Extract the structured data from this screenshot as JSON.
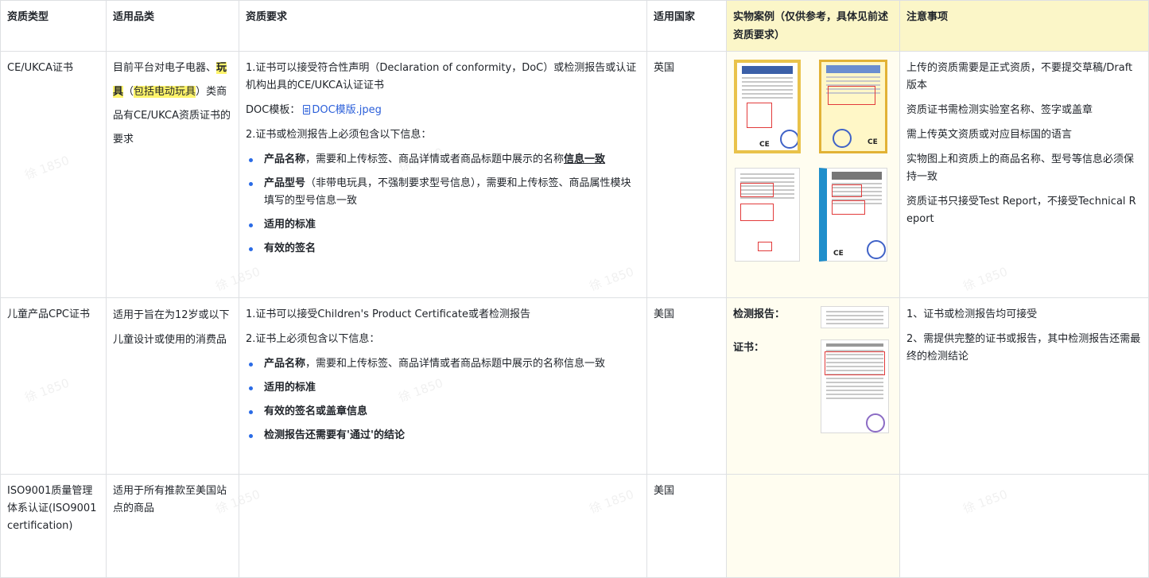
{
  "headers": [
    "资质类型",
    "适用品类",
    "资质要求",
    "适用国家",
    "实物案例（仅供参考，具体见前述资质要求）",
    "注意事项"
  ],
  "watermark": "徐 1850",
  "row1": {
    "type": "CE/UKCA证书",
    "category_pre": "目前平台对电子电器、",
    "category_hl1": "玩具",
    "category_paren_open": "（",
    "category_hl2": "包括电动玩具",
    "category_paren_close": "）",
    "category_post": "类商品有CE/UKCA资质证书的要求",
    "req_p1": "1.证书可以接受符合性声明（Declaration of conformity，DoC）或检测报告或认证机构出具的CE/UKCA认证证书",
    "doc_label": "DOC模板：",
    "doc_link": "DOC模版.jpeg",
    "req_p2": "2.证书或检测报告上必须包含以下信息：",
    "bullet1_b": "产品名称",
    "bullet1_t": "，需要和上传标签、商品详情或者商品标题中展示的名称",
    "bullet1_b2": "信息一致",
    "bullet2_b": "产品型号",
    "bullet2_t": "（非带电玩具，不强制要求型号信息），需要和上传标签、商品属性模块填写的型号信息一致",
    "bullet3_b": "适用的标准",
    "bullet4_b": "有效的签名",
    "country": "英国",
    "notes": [
      "上传的资质需要是正式资质，不要提交草稿/Draft版本",
      "资质证书需检测实验室名称、签字或盖章",
      "需上传英文资质或对应目标国的语言",
      "实物图上和资质上的商品名称、型号等信息必须保持一致",
      "资质证书只接受Test Report，不接受Technical Report"
    ]
  },
  "row2": {
    "type": "儿童产品CPC证书",
    "category": "适用于旨在为12岁或以下儿童设计或使用的消费品",
    "req_p1": "1.证书可以接受Children's Product Certificate或者检测报告",
    "req_p2": "2.证书上必须包含以下信息：",
    "bullet1_b": "产品名称",
    "bullet1_t": "，需要和上传标签、商品详情或者商品标题中展示的名称信息一致",
    "bullet2_b": "适用的标准",
    "bullet3_b": "有效的签名或盖章信息",
    "bullet4_b": "检测报告还需要有'通过'的结论",
    "country": "美国",
    "example_report_label": "检测报告：",
    "example_cert_label": "证书：",
    "notes": [
      "1、证书或检测报告均可接受",
      "2、需提供完整的证书或报告，其中检测报告还需最终的检测结论"
    ]
  },
  "row3": {
    "type": "ISO9001质量管理体系认证(ISO9001 certification)",
    "category": "适用于所有推款至美国站点的商品",
    "country": "美国"
  },
  "thumb_text": {
    "ce": "CE"
  },
  "colors": {
    "highlight": "#fff46b",
    "header_hl": "#fbf6c8",
    "link": "#2b5fd9",
    "bullet": "#2a6be6"
  }
}
